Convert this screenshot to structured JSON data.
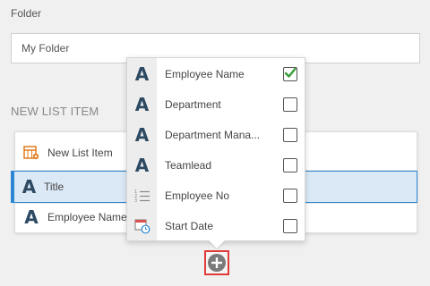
{
  "folder": {
    "label": "Folder",
    "value": "My Folder"
  },
  "section": {
    "heading": "NEW LIST ITEM"
  },
  "list": {
    "rows": [
      {
        "label": "New List Item",
        "icon": "list-item-icon"
      },
      {
        "label": "Title",
        "icon": "text-field-icon",
        "selected": true
      },
      {
        "label": "Employee Name",
        "icon": "text-field-icon"
      }
    ]
  },
  "field_picker": {
    "items": [
      {
        "label": "Employee Name",
        "icon": "text-field-icon",
        "checked": true
      },
      {
        "label": "Department",
        "icon": "text-field-icon",
        "checked": false
      },
      {
        "label": "Department Mana...",
        "icon": "text-field-icon",
        "checked": false
      },
      {
        "label": "Teamlead",
        "icon": "text-field-icon",
        "checked": false
      },
      {
        "label": "Employee No",
        "icon": "number-list-icon",
        "checked": false
      },
      {
        "label": "Start Date",
        "icon": "calendar-clock-icon",
        "checked": false
      }
    ]
  },
  "colors": {
    "accent": "#2a86d1",
    "check_green": "#3a9c3a",
    "add_button_highlight": "#e03a3a",
    "text_icon": "#2d4a63"
  }
}
